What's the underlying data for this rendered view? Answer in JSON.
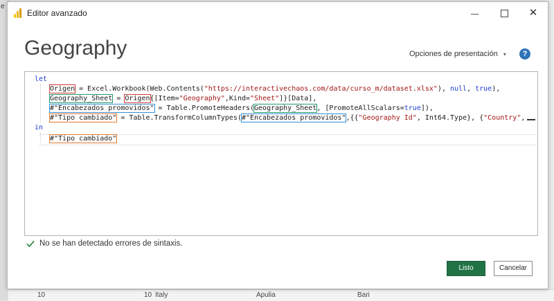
{
  "background": {
    "left_letter": "e",
    "bottom_row": [
      "10",
      "10",
      "Italy",
      "Apulia",
      "Bari"
    ]
  },
  "window": {
    "title": "Editor avanzado",
    "app_icon": "power-bi-icon",
    "minimize_icon": "minimize-icon",
    "maximize_icon": "maximize-icon",
    "close_icon": "close-icon"
  },
  "header": {
    "query_name": "Geography",
    "display_options_label": "Opciones de presentación",
    "display_options_caret": "▾",
    "help_label": "?"
  },
  "editor": {
    "lines": {
      "l1": {
        "kw": "let"
      },
      "l2": {
        "t1": "Origen",
        "t2": " = Excel.Workbook(Web.Contents(",
        "t3": "\"https://interactivechaos.com/data/curso_m/dataset.xlsx\"",
        "t4": "), ",
        "t5": "null",
        "t6": ", ",
        "t7": "true",
        "t8": "),"
      },
      "l3": {
        "t1": "Geography_Sheet",
        "t2": " = ",
        "t3": "Origen",
        "t4": "{[Item=",
        "t5": "\"Geography\"",
        "t6": ",Kind=",
        "t7": "\"Sheet\"",
        "t8": "]}[Data],"
      },
      "l4": {
        "t1": "#\"Encabezados promovidos\"",
        "t2": " = Table.PromoteHeaders(",
        "t3": "Geography_Sheet",
        "t4": ", [PromoteAllScalars=",
        "t5": "true",
        "t6": "]),"
      },
      "l5": {
        "t1": "#\"Tipo cambiado\"",
        "t2": " = Table.TransformColumnTypes(",
        "t3": "#\"Encabezados promovidos\"",
        "t4": ",{{",
        "t5": "\"Geography Id\"",
        "t6": ", Int64.Type}, {",
        "t7": "\"Country\"",
        "t8": ","
      },
      "l6": {
        "kw": "in"
      },
      "l7": {
        "t1": "#\"Tipo cambiado\""
      }
    }
  },
  "status": {
    "icon": "checkmark-icon",
    "text": "No se han detectado errores de sintaxis."
  },
  "buttons": {
    "ok": "Listo",
    "cancel": "Cancelar"
  },
  "colors": {
    "accent": "#217346",
    "help": "#2e73b8",
    "keyword": "#1c3ad4",
    "string": "#a31515",
    "box_red": "#d23a3a",
    "box_green": "#1e9a6a",
    "box_blue": "#2f8fd6",
    "box_orange": "#e0782e"
  }
}
